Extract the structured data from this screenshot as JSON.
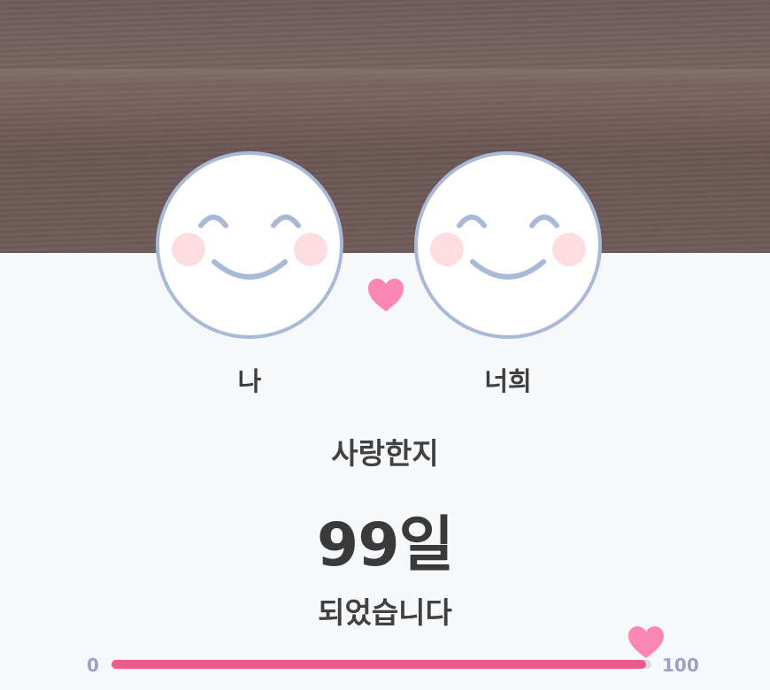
{
  "couple": {
    "me_label": "나",
    "you_label": "너희",
    "avatar_icon": "smiley-face-icon",
    "link_icon": "heart-icon"
  },
  "counter": {
    "caption_top": "사랑한지",
    "days_text": "99일",
    "caption_bottom": "되었습니다"
  },
  "progress": {
    "min_label": "0",
    "max_label": "100",
    "value": 99,
    "thumb_icon": "heart-icon"
  },
  "colors": {
    "accent_pink": "#ee5a8b",
    "heart_pink": "#fb87b4",
    "avatar_outline": "#a9b9d8",
    "cheek": "#fddde0"
  }
}
